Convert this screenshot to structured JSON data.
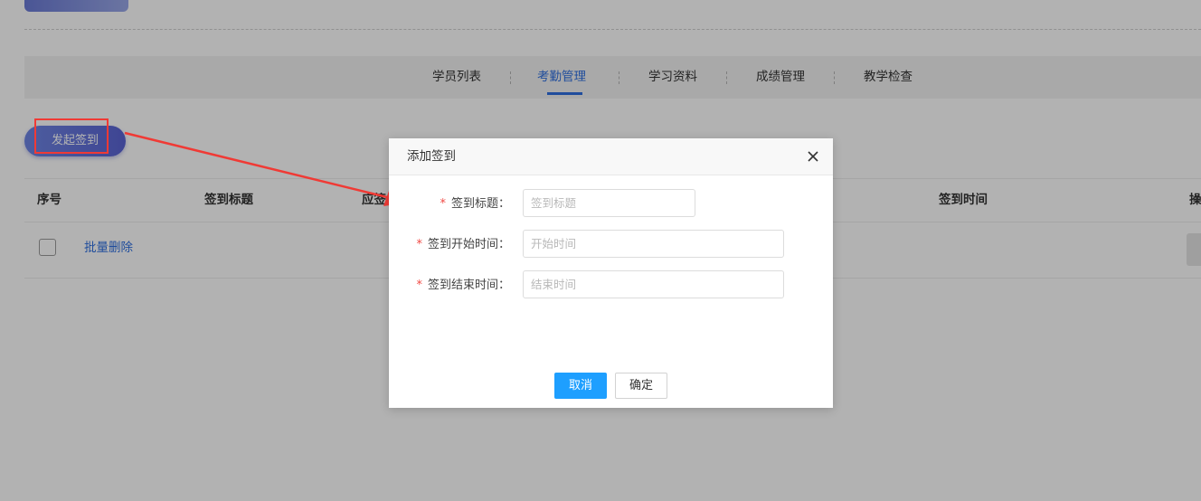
{
  "tabs": [
    {
      "label": "学员列表"
    },
    {
      "label": "考勤管理",
      "active": true
    },
    {
      "label": "学习资料"
    },
    {
      "label": "成绩管理"
    },
    {
      "label": "教学检查"
    }
  ],
  "toolbar": {
    "launch_label": "发起签到"
  },
  "table": {
    "columns": [
      "序号",
      "签到标题",
      "应签",
      "签到时间",
      "操"
    ],
    "batch_delete_label": "批量删除"
  },
  "dialog": {
    "title": "添加签到",
    "fields": [
      {
        "label": "签到标题：",
        "placeholder": "签到标题",
        "value": ""
      },
      {
        "label": "签到开始时间：",
        "placeholder": "开始时间",
        "value": ""
      },
      {
        "label": "签到结束时间：",
        "placeholder": "结束时间",
        "value": ""
      }
    ],
    "required_mark": "*",
    "cancel_label": "取消",
    "confirm_label": "确定"
  },
  "colors": {
    "accent": "#2e6fe0",
    "primary_button": "#1e9fff",
    "annotation_red": "#f03a35"
  },
  "icons": {
    "close": "close-icon",
    "arrow": "annotation-arrow"
  }
}
